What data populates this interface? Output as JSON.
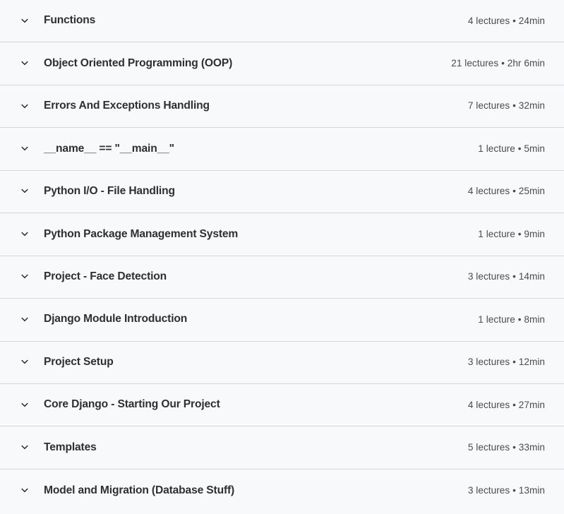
{
  "colors": {
    "row_background": "#f7f9fa",
    "divider": "#d1d7dc",
    "title_text": "#2d2f31",
    "meta_text": "#4a4c4d"
  },
  "curriculum": {
    "icon": "chevron-down-icon",
    "sections": [
      {
        "title": "Functions",
        "meta": "4 lectures • 24min",
        "lectures": "4 lectures",
        "duration": "24min"
      },
      {
        "title": "Object Oriented Programming (OOP)",
        "meta": "21 lectures • 2hr 6min",
        "lectures": "21 lectures",
        "duration": "2hr 6min"
      },
      {
        "title": "Errors And Exceptions Handling",
        "meta": "7 lectures • 32min",
        "lectures": "7 lectures",
        "duration": "32min"
      },
      {
        "title": "__name__ == \"__main__\"",
        "meta": "1 lecture • 5min",
        "lectures": "1 lecture",
        "duration": "5min"
      },
      {
        "title": "Python I/O - File Handling",
        "meta": "4 lectures • 25min",
        "lectures": "4 lectures",
        "duration": "25min"
      },
      {
        "title": "Python Package Management System",
        "meta": "1 lecture • 9min",
        "lectures": "1 lecture",
        "duration": "9min"
      },
      {
        "title": "Project - Face Detection",
        "meta": "3 lectures • 14min",
        "lectures": "3 lectures",
        "duration": "14min"
      },
      {
        "title": "Django Module Introduction",
        "meta": "1 lecture • 8min",
        "lectures": "1 lecture",
        "duration": "8min"
      },
      {
        "title": "Project Setup",
        "meta": "3 lectures • 12min",
        "lectures": "3 lectures",
        "duration": "12min"
      },
      {
        "title": "Core Django - Starting Our Project",
        "meta": "4 lectures • 27min",
        "lectures": "4 lectures",
        "duration": "27min"
      },
      {
        "title": "Templates",
        "meta": "5 lectures • 33min",
        "lectures": "5 lectures",
        "duration": "33min"
      },
      {
        "title": "Model and Migration (Database Stuff)",
        "meta": "3 lectures • 13min",
        "lectures": "3 lectures",
        "duration": "13min"
      }
    ]
  }
}
